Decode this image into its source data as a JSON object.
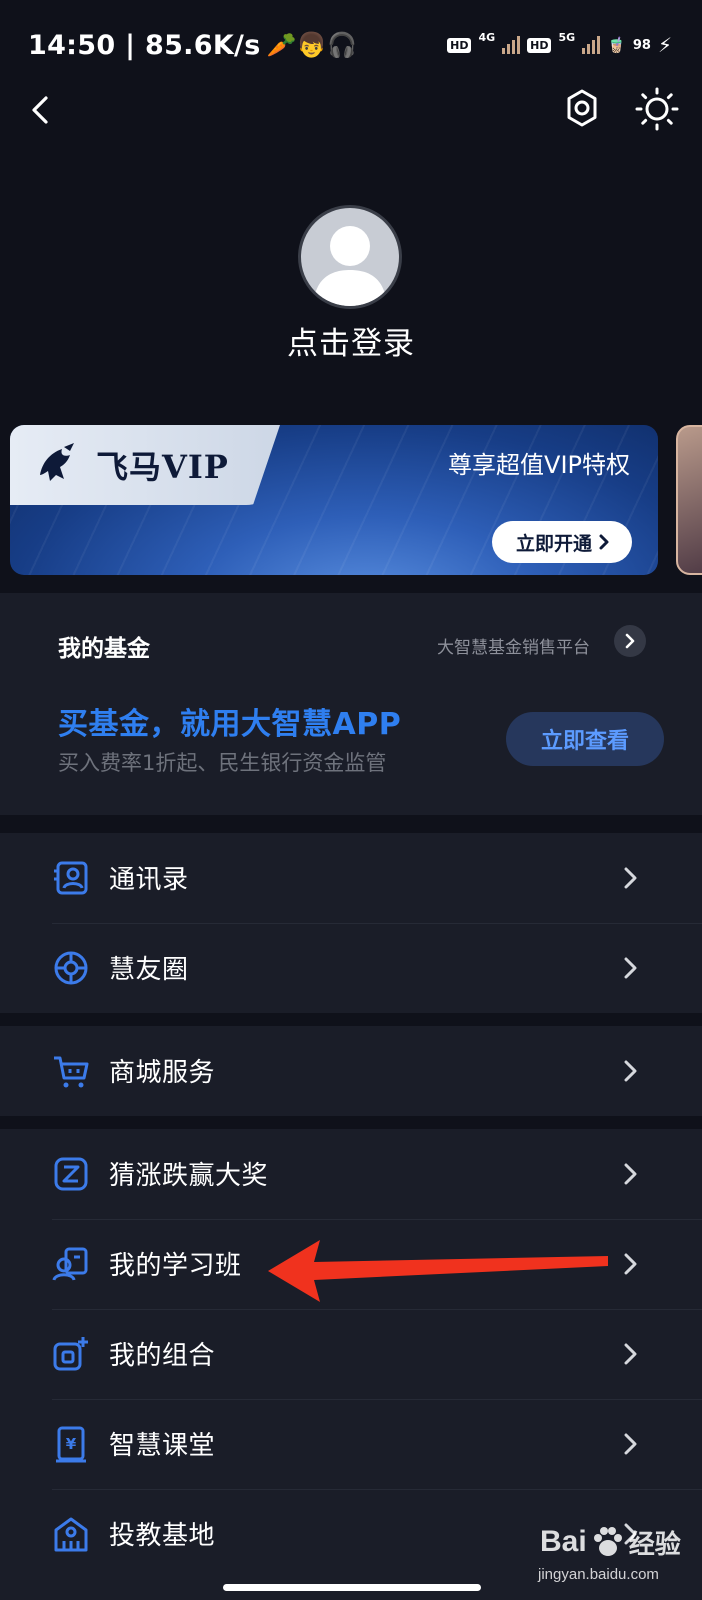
{
  "status_bar": {
    "time_speed": "14:50 | 85.6K/s",
    "emojis": "🥕👦🎧",
    "network_1": "4G",
    "network_2": "5G",
    "hd": "HD",
    "battery": "98"
  },
  "profile": {
    "login_text": "点击登录"
  },
  "vip_banner": {
    "name": "飞马VIP",
    "slogan": "尊享超值VIP特权",
    "button_label": "立即开通"
  },
  "fund": {
    "title": "我的基金",
    "platform": "大智慧基金销售平台",
    "headline": "买基金，就用大智慧APP",
    "subline": "买入费率1折起、民生银行资金监管",
    "button_label": "立即查看"
  },
  "menu": {
    "contacts": "通讯录",
    "friends_circle": "慧友圈",
    "mall_service": "商城服务",
    "guess_prize": "猜涨跌赢大奖",
    "study_class": "我的学习班",
    "my_portfolio": "我的组合",
    "wisdom_class": "智慧课堂",
    "investor_education": "投教基地"
  },
  "watermark": {
    "brand": "Bai",
    "brand_suffix": "经验",
    "url": "jingyan.baidu.com"
  },
  "colors": {
    "background": "#0f111a",
    "card": "#1a1d28",
    "accent_blue": "#2f7ff0",
    "icon_blue": "#3c7bea",
    "annotation_red": "#f0321e"
  },
  "icons": [
    "back-icon",
    "settings-gear-icon",
    "brightness-sun-icon",
    "chevron-right-icon",
    "contacts-icon",
    "friends-circle-icon",
    "cart-icon",
    "guess-icon",
    "study-class-icon",
    "portfolio-icon",
    "classroom-icon",
    "education-base-icon"
  ]
}
